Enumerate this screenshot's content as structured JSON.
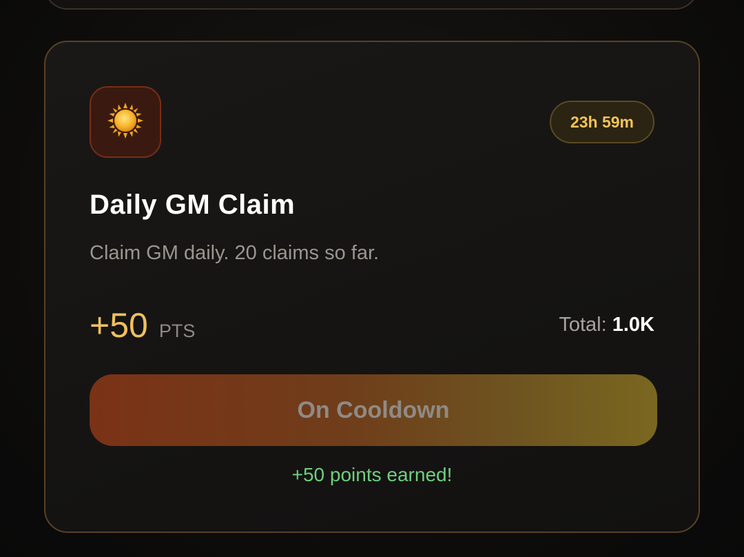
{
  "task": {
    "icon": "sun-icon",
    "timer": "23h 59m",
    "title": "Daily GM Claim",
    "description": "Claim GM daily. 20 claims so far.",
    "reward_value": "+50",
    "reward_unit": "PTS",
    "total_label": "Total:",
    "total_value": "1.0K",
    "button_label": "On Cooldown",
    "earned_message": "+50 points earned!"
  },
  "colors": {
    "accent_gold": "#f0c060",
    "success_green": "#6fcf7f",
    "card_border": "#5a4126"
  }
}
